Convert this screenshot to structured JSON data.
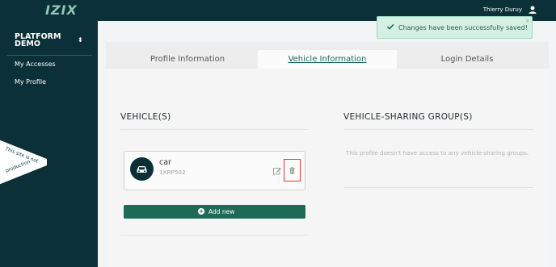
{
  "header": {
    "logo_text": "IZIX",
    "user_name": "Thierry Duruy",
    "user_icon": "user-icon"
  },
  "sidebar": {
    "platform_name": "PLATFORM DEMO",
    "toggle_icon": "chevron-up-down-icon",
    "items": [
      {
        "label": "My Accesses"
      },
      {
        "label": "My Profile"
      }
    ],
    "ribbon": {
      "line1": "This site is not",
      "line2": "production"
    }
  },
  "tabs": [
    {
      "label": "Profile Information",
      "active": false
    },
    {
      "label": "Vehicle Information",
      "active": true
    },
    {
      "label": "Login Details",
      "active": false
    }
  ],
  "vehicles": {
    "title": "VEHICLE(S)",
    "items": [
      {
        "name": "car",
        "plate": "1XRP502",
        "icon": "car-icon"
      }
    ],
    "add_label": "Add new"
  },
  "sharing_groups": {
    "title": "VEHICLE-SHARING GROUP(S)",
    "empty_message": "This profile doesn't have access to any vehicle-sharing groups."
  },
  "toast": {
    "message": "Changes have been successfully saved!",
    "close_symbol": "×"
  },
  "colors": {
    "dark_teal": "#0b3038",
    "accent_green": "#1e6a56",
    "toast_bg": "#d4efe4",
    "highlight_red": "#e3342f"
  }
}
